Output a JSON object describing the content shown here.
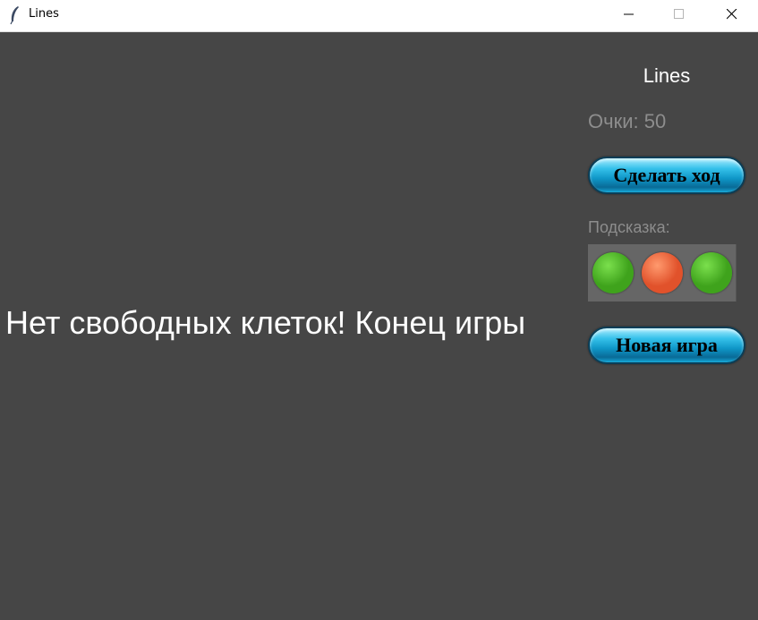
{
  "window": {
    "title": "Lines"
  },
  "sidebar": {
    "title": "Lines",
    "score_text": "Очки: 50",
    "move_button": "Сделать ход",
    "hint_label": "Подсказка:",
    "hint_balls": [
      {
        "color": "#3fa31c",
        "highlight": "#7be04d"
      },
      {
        "color": "#e1522b",
        "highlight": "#ff9a6e"
      },
      {
        "color": "#3fa31c",
        "highlight": "#7be04d"
      }
    ],
    "new_game_button": "Новая игра"
  },
  "game": {
    "message": "Нет свободных клеток! Конец игры"
  }
}
